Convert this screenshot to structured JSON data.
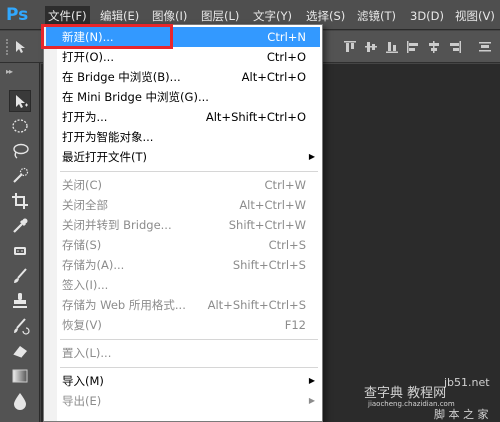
{
  "app": {
    "logo": "Ps"
  },
  "menubar": {
    "items": [
      "文件(F)",
      "编辑(E)",
      "图像(I)",
      "图层(L)",
      "文字(Y)",
      "选择(S)",
      "滤镜(T)",
      "3D(D)",
      "视图(V)"
    ]
  },
  "file_menu": {
    "items": [
      {
        "label": "新建(N)...",
        "shortcut": "Ctrl+N",
        "state": "highlighted"
      },
      {
        "label": "打开(O)...",
        "shortcut": "Ctrl+O",
        "state": "enabled"
      },
      {
        "label": "在 Bridge 中浏览(B)...",
        "shortcut": "Alt+Ctrl+O",
        "state": "enabled"
      },
      {
        "label": "在 Mini Bridge 中浏览(G)...",
        "shortcut": "",
        "state": "enabled"
      },
      {
        "label": "打开为...",
        "shortcut": "Alt+Shift+Ctrl+O",
        "state": "enabled"
      },
      {
        "label": "打开为智能对象...",
        "shortcut": "",
        "state": "enabled"
      },
      {
        "label": "最近打开文件(T)",
        "shortcut": "",
        "state": "submenu"
      },
      {
        "label": "关闭(C)",
        "shortcut": "Ctrl+W",
        "state": "disabled"
      },
      {
        "label": "关闭全部",
        "shortcut": "Alt+Ctrl+W",
        "state": "disabled"
      },
      {
        "label": "关闭并转到 Bridge...",
        "shortcut": "Shift+Ctrl+W",
        "state": "disabled"
      },
      {
        "label": "存储(S)",
        "shortcut": "Ctrl+S",
        "state": "disabled"
      },
      {
        "label": "存储为(A)...",
        "shortcut": "Shift+Ctrl+S",
        "state": "disabled"
      },
      {
        "label": "签入(I)...",
        "shortcut": "",
        "state": "disabled"
      },
      {
        "label": "存储为 Web 所用格式...",
        "shortcut": "Alt+Shift+Ctrl+S",
        "state": "disabled"
      },
      {
        "label": "恢复(V)",
        "shortcut": "F12",
        "state": "disabled"
      },
      {
        "label": "置入(L)...",
        "shortcut": "",
        "state": "disabled"
      },
      {
        "label": "导入(M)",
        "shortcut": "",
        "state": "submenu"
      },
      {
        "label": "导出(E)",
        "shortcut": "",
        "state": "submenu-disabled"
      }
    ]
  },
  "watermark": {
    "line1": "查字典 教程网",
    "line2": "jiaocheng.chazidian.com",
    "line3": "jb51.net",
    "line4": "脚 本 之 家"
  },
  "colors": {
    "highlight": "#3399ff",
    "annotation_box": "#e8262b",
    "ps_blue": "#31a8ff"
  }
}
